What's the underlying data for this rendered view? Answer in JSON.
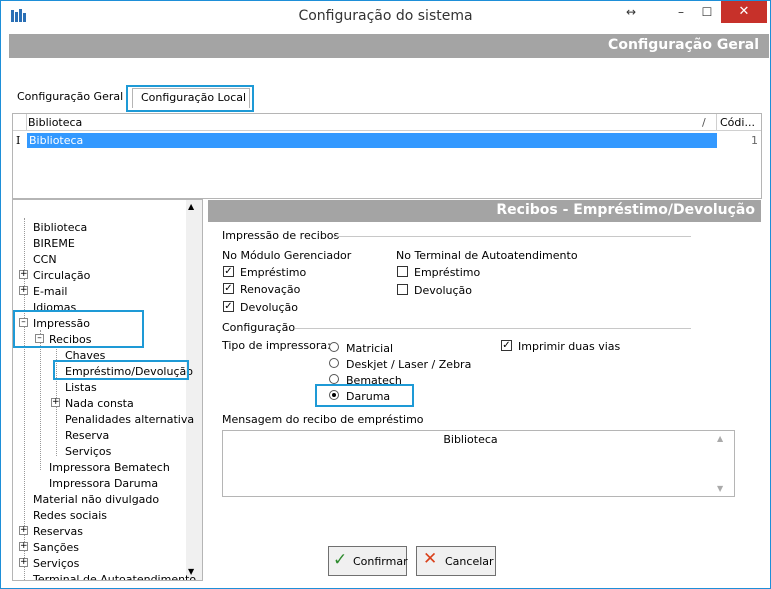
{
  "window": {
    "title": "Configuração do sistema",
    "resize_glyph": "↔",
    "minimize_glyph": "–",
    "maximize_glyph": "☐",
    "close_glyph": "✕"
  },
  "header": {
    "title": "Configuração Geral"
  },
  "tabs": [
    {
      "label": "Configuração Geral"
    },
    {
      "label": "Configuração Local"
    }
  ],
  "grid": {
    "columns": [
      "Biblioteca",
      "Códi..."
    ],
    "sort_glyph": "/",
    "rows": [
      {
        "marker": "I",
        "name": "Biblioteca",
        "code": "1"
      }
    ]
  },
  "tree": {
    "items": [
      {
        "label": "Biblioteca"
      },
      {
        "label": "BIREME"
      },
      {
        "label": "CCN"
      },
      {
        "label": "Circulação",
        "expander": "+"
      },
      {
        "label": "E-mail",
        "expander": "+"
      },
      {
        "label": "Idiomas"
      },
      {
        "label": "Impressão",
        "expander": "–"
      },
      {
        "label": "Recibos",
        "expander": "–"
      },
      {
        "label": "Chaves"
      },
      {
        "label": "Empréstimo/Devolução"
      },
      {
        "label": "Listas"
      },
      {
        "label": "Nada consta",
        "expander": "+"
      },
      {
        "label": "Penalidades alternativa"
      },
      {
        "label": "Reserva"
      },
      {
        "label": "Serviços"
      },
      {
        "label": "Impressora Bematech"
      },
      {
        "label": "Impressora Daruma"
      },
      {
        "label": "Material não divulgado"
      },
      {
        "label": "Redes sociais"
      },
      {
        "label": "Reservas",
        "expander": "+"
      },
      {
        "label": "Sanções",
        "expander": "+"
      },
      {
        "label": "Serviços",
        "expander": "+"
      },
      {
        "label": "Terminal de Autoatendimento"
      }
    ]
  },
  "panel": {
    "title": "Recibos - Empréstimo/Devolução",
    "printing_section": "Impressão de recibos",
    "module_group": {
      "title": "No Módulo Gerenciador",
      "options": [
        {
          "label": "Empréstimo",
          "checked": true
        },
        {
          "label": "Renovação",
          "checked": true
        },
        {
          "label": "Devolução",
          "checked": true
        }
      ]
    },
    "terminal_group": {
      "title": "No Terminal de Autoatendimento",
      "options": [
        {
          "label": "Empréstimo",
          "checked": false
        },
        {
          "label": "Devolução",
          "checked": false
        }
      ]
    },
    "config_section": "Configuração",
    "printer_type_label": "Tipo de impressora:",
    "printer_options": [
      {
        "label": "Matricial",
        "selected": false
      },
      {
        "label": "Deskjet / Laser / Zebra",
        "selected": false
      },
      {
        "label": "Bematech",
        "selected": false
      },
      {
        "label": "Daruma",
        "selected": true
      }
    ],
    "two_copies": {
      "label": "Imprimir duas vias",
      "checked": true
    },
    "message_label": "Mensagem do recibo de empréstimo",
    "message_value": "Biblioteca"
  },
  "buttons": {
    "confirm": "Confirmar",
    "cancel": "Cancelar"
  },
  "colors": {
    "accent": "#1e9ad6",
    "selection": "#3399ff",
    "header_grey": "#a4a4a4",
    "close_red": "#c7312a",
    "confirm_green": "#2e8b2e",
    "cancel_red": "#d9401a"
  },
  "check_glyph": "✓",
  "scroll": {
    "up_glyph": "▲",
    "down_glyph": "▼"
  }
}
